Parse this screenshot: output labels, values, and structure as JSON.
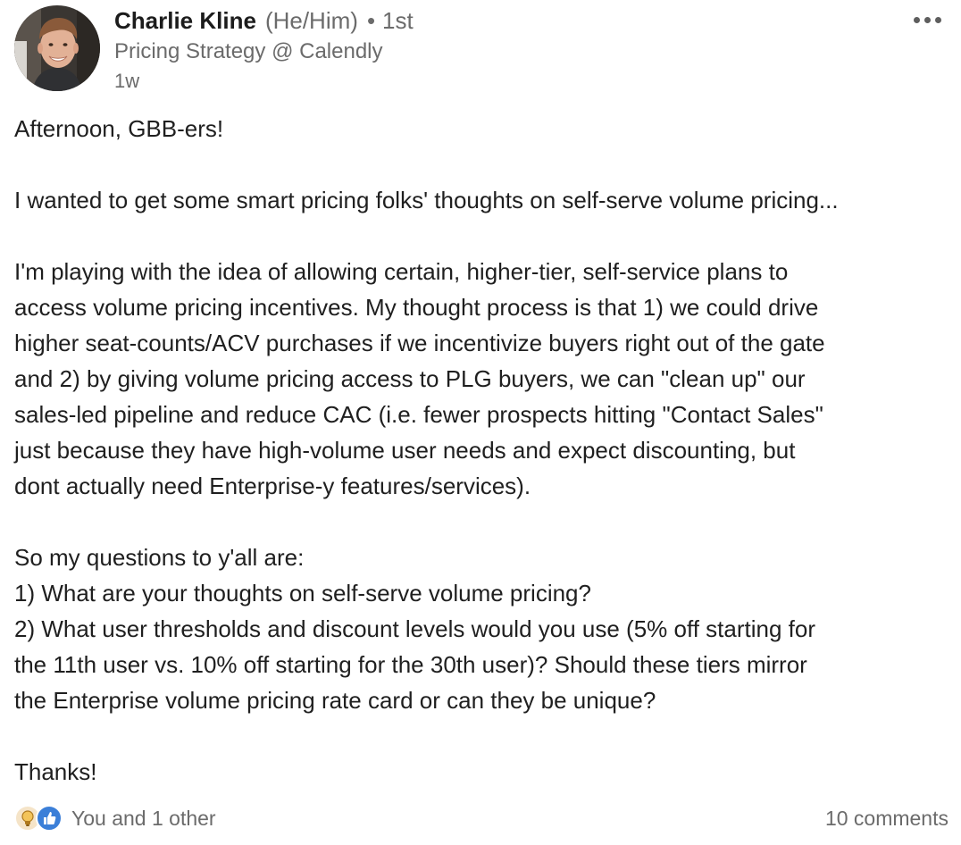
{
  "author": {
    "name": "Charlie Kline",
    "pronouns": "(He/Him)",
    "separator": "•",
    "degree": "1st",
    "headline": "Pricing Strategy @ Calendly",
    "timestamp": "1w",
    "avatar_icon": "avatar-photo"
  },
  "menu": {
    "icon": "more-options-icon"
  },
  "body": {
    "lines": [
      "Afternoon, GBB-ers!",
      "",
      "I wanted to get some smart pricing folks' thoughts on self-serve volume pricing...",
      "",
      "I'm playing with the idea of allowing certain, higher-tier, self-service plans to",
      "access volume pricing incentives. My thought process is that 1) we could drive",
      "higher seat-counts/ACV purchases if we incentivize buyers right out of the gate",
      "and 2) by giving volume pricing access to PLG buyers, we can \"clean up\" our",
      "sales-led pipeline and reduce CAC (i.e. fewer prospects hitting \"Contact Sales\"",
      "just because they have high-volume user needs and expect discounting, but",
      "dont actually need Enterprise-y features/services).",
      "",
      "So my questions to y'all are:",
      "1) What are your thoughts on self-serve volume pricing?",
      "2) What user thresholds and discount levels would you use (5% off starting for",
      "the 11th user vs. 10% off starting for the 30th user)? Should these tiers mirror",
      "the Enterprise volume pricing rate card or can they be unique?",
      "",
      "Thanks!"
    ]
  },
  "footer": {
    "reactions_text": "You and 1 other",
    "reaction_icons": [
      "insightful-bulb-icon",
      "like-thumb-icon"
    ],
    "comments_text": "10 comments"
  },
  "colors": {
    "text_primary": "#1f1f1f",
    "text_secondary": "#6b6b6b",
    "like_blue": "#3b7fd8",
    "insightful_tan": "#f5e4c8"
  }
}
